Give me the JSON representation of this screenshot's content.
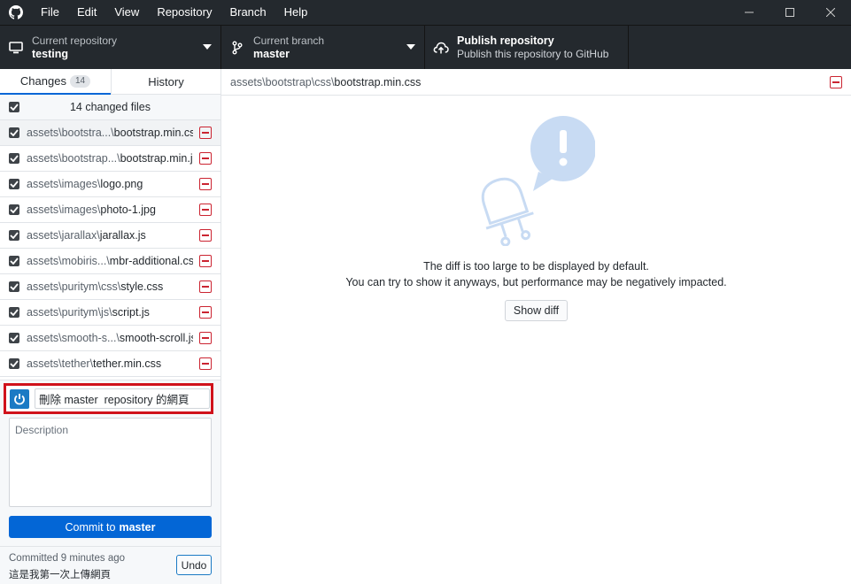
{
  "menu": [
    "File",
    "Edit",
    "View",
    "Repository",
    "Branch",
    "Help"
  ],
  "toolbar": {
    "repo_label": "Current repository",
    "repo_value": "testing",
    "branch_label": "Current branch",
    "branch_value": "master",
    "publish_title": "Publish repository",
    "publish_sub": "Publish this repository to GitHub"
  },
  "tabs": {
    "changes": "Changes",
    "changes_count": "14",
    "history": "History"
  },
  "changed_header": "14 changed files",
  "files": [
    {
      "dir": "assets\\bootstra...\\",
      "base": "bootstrap.min.css"
    },
    {
      "dir": "assets\\bootstrap...\\",
      "base": "bootstrap.min.js"
    },
    {
      "dir": "assets\\images\\",
      "base": "logo.png"
    },
    {
      "dir": "assets\\images\\",
      "base": "photo-1.jpg"
    },
    {
      "dir": "assets\\jarallax\\",
      "base": "jarallax.js"
    },
    {
      "dir": "assets\\mobiris...\\",
      "base": "mbr-additional.css"
    },
    {
      "dir": "assets\\puritym\\css\\",
      "base": "style.css"
    },
    {
      "dir": "assets\\puritym\\js\\",
      "base": "script.js"
    },
    {
      "dir": "assets\\smooth-s...\\",
      "base": "smooth-scroll.js"
    },
    {
      "dir": "assets\\tether\\",
      "base": "tether.min.css"
    }
  ],
  "commit": {
    "summary_value": "刪除 master  repository 的網頁",
    "description_placeholder": "Description",
    "button_prefix": "Commit to",
    "button_branch": "master"
  },
  "last_commit": {
    "time": "Committed 9 minutes ago",
    "message": "這是我第一次上傳網頁",
    "undo": "Undo"
  },
  "main": {
    "path_dir": "assets\\bootstrap\\css\\",
    "path_base": "bootstrap.min.css",
    "msg_line1": "The diff is too large to be displayed by default.",
    "msg_line2": "You can try to show it anyways, but performance may be negatively impacted.",
    "show_diff": "Show diff"
  },
  "colors": {
    "accent": "#0366d6",
    "danger": "#cb2431",
    "highlight_box": "#d0121b",
    "dark": "#24292e"
  }
}
